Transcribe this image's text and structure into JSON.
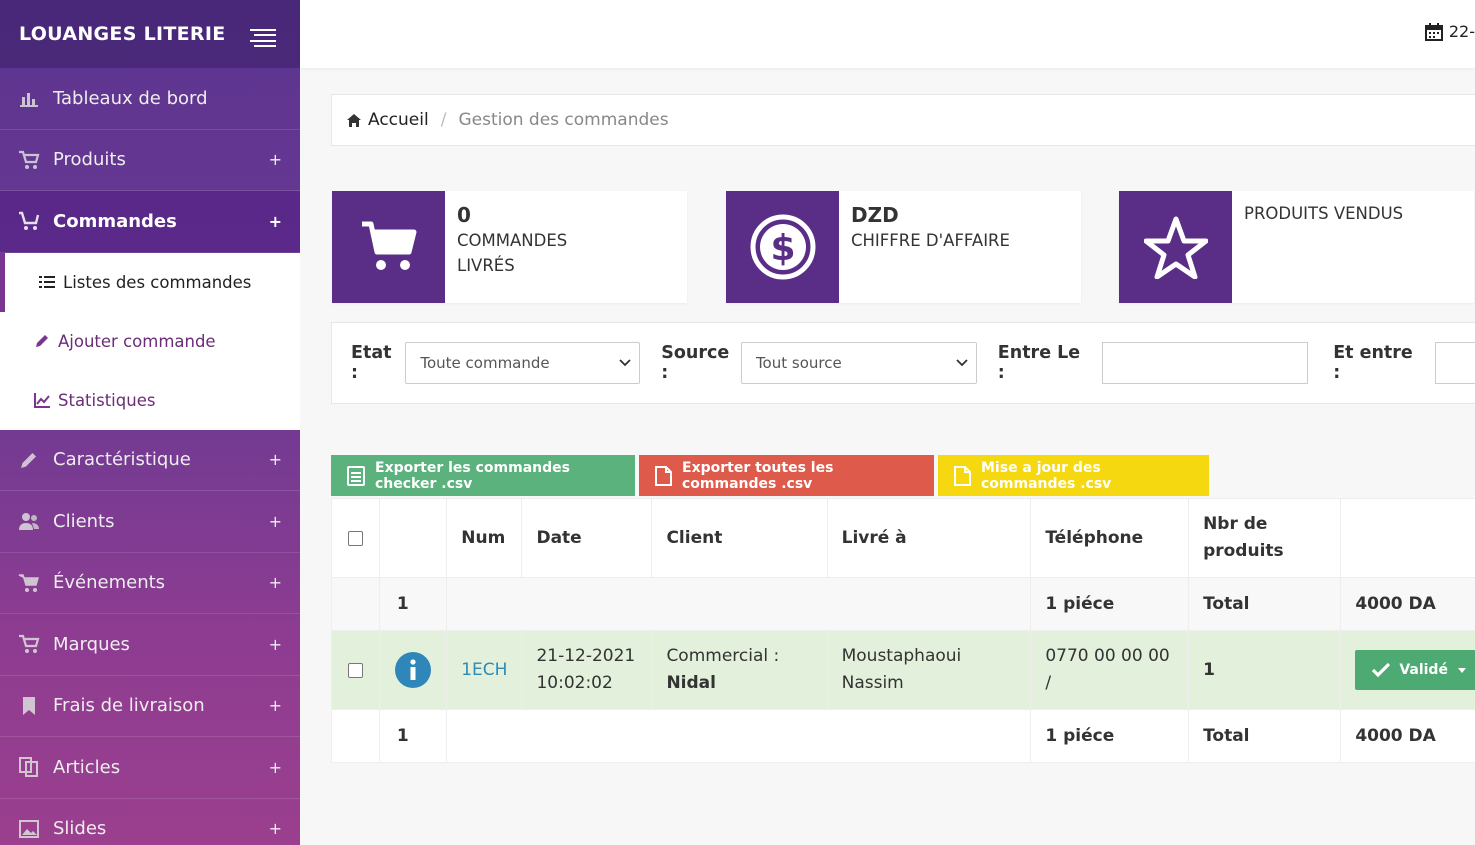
{
  "sidebar": {
    "brand": "LOUANGES LITERIE",
    "items": [
      {
        "label": "Tableaux de bord",
        "icon": "bar-chart-icon",
        "plus": ""
      },
      {
        "label": "Produits",
        "icon": "cart-icon",
        "plus": "+"
      },
      {
        "label": "Commandes",
        "icon": "cart-outline-icon",
        "plus": "+"
      },
      {
        "label": "Caractéristique",
        "icon": "pencil-icon",
        "plus": "+"
      },
      {
        "label": "Clients",
        "icon": "users-icon",
        "plus": "+"
      },
      {
        "label": "Événements",
        "icon": "cart-icon",
        "plus": "+"
      },
      {
        "label": "Marques",
        "icon": "cart-icon",
        "plus": "+"
      },
      {
        "label": "Frais de livraison",
        "icon": "bookmark-icon",
        "plus": "+"
      },
      {
        "label": "Articles",
        "icon": "copy-icon",
        "plus": "+"
      },
      {
        "label": "Slides",
        "icon": "image-icon",
        "plus": "+"
      }
    ],
    "submenu": [
      {
        "label": "Listes des commandes",
        "icon": "list-icon"
      },
      {
        "label": "Ajouter commande",
        "icon": "pencil-icon"
      },
      {
        "label": "Statistiques",
        "icon": "line-chart-icon"
      }
    ]
  },
  "topbar": {
    "date": "22-"
  },
  "breadcrumb": {
    "home": "Accueil",
    "sep": "/",
    "current": "Gestion des commandes"
  },
  "cards": [
    {
      "value": "0",
      "line1": "COMMANDES",
      "line2": "LIVRÉS",
      "icon": "cart-icon"
    },
    {
      "value": "DZD",
      "line1": "CHIFFRE D'AFFAIRE",
      "line2": "",
      "icon": "dollar-icon"
    },
    {
      "value": "",
      "line1": "PRODUITS VENDUS",
      "line2": "",
      "icon": "star-icon"
    }
  ],
  "filters": {
    "etat_label": "Etat :",
    "etat_value": "Toute commande",
    "source_label": "Source :",
    "source_value": "Tout source",
    "entre_label": "Entre Le :",
    "et_entre_label": "Et entre :"
  },
  "buttons": {
    "export_checker": "Exporter les commandes checker .csv",
    "export_all": "Exporter toutes les commandes .csv",
    "update": "Mise a jour des commandes .csv"
  },
  "colors": {
    "green": "#5bb27d",
    "red": "#de5a4b",
    "yellow": "#f5d80f",
    "purple": "#5a2e86"
  },
  "table": {
    "headers": {
      "num": "Num",
      "date": "Date",
      "client": "Client",
      "livre": "Livré à",
      "tel": "Téléphone",
      "nbr1": "Nbr de",
      "nbr2": "produits"
    },
    "summary": {
      "count": "1",
      "pieces": "1 piéce",
      "total_label": "Total",
      "total": "4000 DA"
    },
    "row": {
      "num": "1ECH",
      "date1": "21-12-2021",
      "date2": "10:02:02",
      "client1": "Commercial :",
      "client2": "Nidal",
      "livre1": "Moustaphaoui",
      "livre2": "Nassim",
      "tel1": "0770 00 00 00",
      "tel2": "/",
      "nbr": "1",
      "status": "Validé"
    }
  }
}
